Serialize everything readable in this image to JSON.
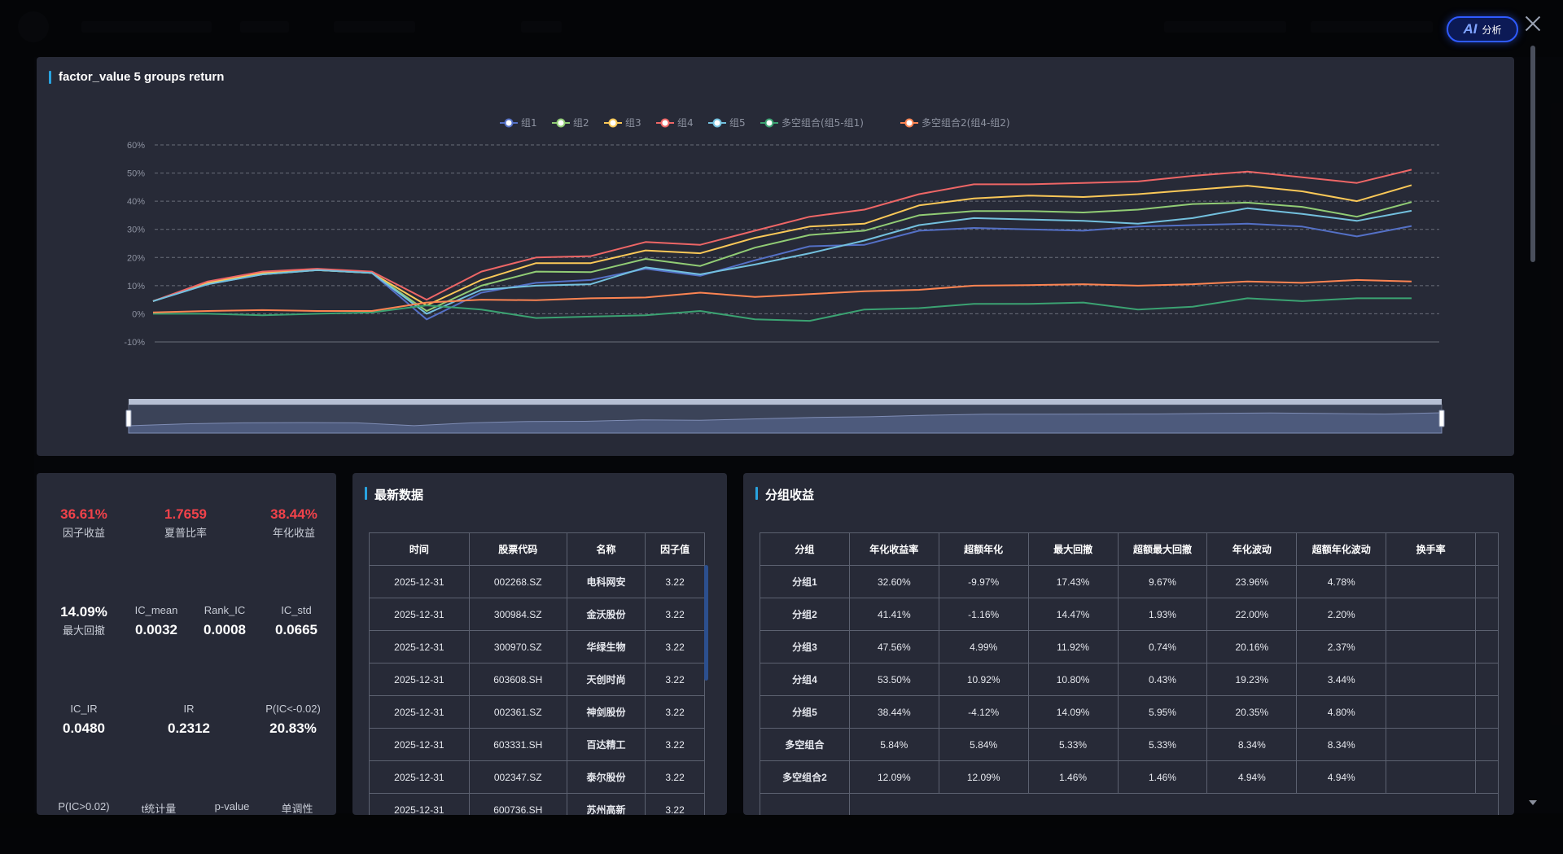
{
  "ai_button": {
    "mark": "AI",
    "label": "分析"
  },
  "chart_panel": {
    "title": "factor_value 5 groups return"
  },
  "chart_data": {
    "type": "line",
    "legend_position": "top-center",
    "grid": true,
    "y_tick_labels": [
      "60%",
      "50%",
      "40%",
      "30%",
      "20%",
      "10%",
      "0%",
      "-10%"
    ],
    "ylim": [
      -10,
      60
    ],
    "series": [
      {
        "name": "组1",
        "color": "#5470c6",
        "values": [
          4.5,
          10.5,
          14,
          15.5,
          14.5,
          -2,
          7.5,
          11,
          12,
          16,
          13.5,
          19,
          24,
          24.5,
          29.5,
          30.5,
          30,
          29.5,
          31,
          31.5,
          32,
          31,
          27.5,
          31.2
        ]
      },
      {
        "name": "组2",
        "color": "#91cc75",
        "values": [
          4.5,
          11,
          14,
          15.5,
          14.5,
          1,
          10,
          15,
          14.8,
          19.5,
          17,
          23.5,
          28,
          29.5,
          35,
          36.5,
          36.5,
          36,
          37,
          39,
          39.5,
          38,
          34.5,
          39.7
        ]
      },
      {
        "name": "组3",
        "color": "#fac858",
        "values": [
          4.5,
          11,
          14.5,
          15.5,
          14.5,
          3,
          12,
          18,
          18,
          22.5,
          21.5,
          27,
          31,
          32,
          38.5,
          41,
          42,
          41.5,
          42.5,
          44,
          45.5,
          43.5,
          40,
          45.7
        ]
      },
      {
        "name": "组4",
        "color": "#ee6666",
        "values": [
          4.5,
          11.5,
          15,
          16,
          15,
          5,
          15,
          20,
          20.5,
          25.5,
          24.5,
          29.5,
          34.5,
          37,
          42.5,
          46,
          46,
          46.5,
          47,
          49,
          50.5,
          48.5,
          46.5,
          51.2
        ]
      },
      {
        "name": "组5",
        "color": "#73c0de",
        "values": [
          4.5,
          10.5,
          14,
          15.5,
          14.5,
          0,
          8.5,
          10,
          10.5,
          16.5,
          14,
          17.5,
          21.5,
          26,
          31.5,
          34,
          33.5,
          33,
          32,
          34,
          37.5,
          35.5,
          33,
          36.6
        ]
      },
      {
        "name": "多空组合(组5-组1)",
        "color": "#3ba272",
        "values": [
          0,
          0,
          -0.5,
          0,
          0.5,
          3,
          1.5,
          -1.5,
          -1,
          -0.5,
          1,
          -2,
          -2.5,
          1.5,
          2,
          3.5,
          3.5,
          4,
          1.5,
          2.5,
          5.5,
          4.5,
          5.5,
          5.5
        ]
      },
      {
        "name": "多空组合2(组4-组2)",
        "color": "#fc8452",
        "values": [
          0.5,
          1,
          1.3,
          1,
          1,
          4,
          5,
          4.8,
          5.5,
          5.8,
          7.5,
          6,
          7,
          8,
          8.5,
          10,
          10.2,
          10.5,
          10,
          10.5,
          11.5,
          11,
          12,
          11.5
        ]
      }
    ],
    "datazoom": {
      "start": 0,
      "end": 100
    }
  },
  "metrics": {
    "factor_return": {
      "value": "36.61%",
      "label": "因子收益"
    },
    "sharpe": {
      "value": "1.7659",
      "label": "夏普比率"
    },
    "annual_return": {
      "value": "38.44%",
      "label": "年化收益"
    },
    "max_drawdown": {
      "value": "14.09%",
      "label": "最大回撤"
    },
    "ic_mean": {
      "value": "0.0032",
      "label": "IC_mean"
    },
    "rank_ic": {
      "value": "0.0008",
      "label": "Rank_IC"
    },
    "ic_std": {
      "value": "0.0665",
      "label": "IC_std"
    },
    "ic_ir": {
      "value": "0.0480",
      "label": "IC_IR"
    },
    "ir": {
      "value": "0.2312",
      "label": "IR"
    },
    "p_ic_neg": {
      "value": "20.83%",
      "label": "P(IC<-0.02)"
    },
    "p_ic_pos": {
      "label": "P(IC>0.02)"
    },
    "t_stat": {
      "label": "t统计量"
    },
    "p_value": {
      "label": "p-value"
    },
    "monotonic": {
      "label": "单调性"
    }
  },
  "latest": {
    "title": "最新数据",
    "headers": [
      "时间",
      "股票代码",
      "名称",
      "因子值"
    ],
    "rows": [
      [
        "2025-12-31",
        "002268.SZ",
        "电科网安",
        "3.22"
      ],
      [
        "2025-12-31",
        "300984.SZ",
        "金沃股份",
        "3.22"
      ],
      [
        "2025-12-31",
        "300970.SZ",
        "华绿生物",
        "3.22"
      ],
      [
        "2025-12-31",
        "603608.SH",
        "天创时尚",
        "3.22"
      ],
      [
        "2025-12-31",
        "002361.SZ",
        "神剑股份",
        "3.22"
      ],
      [
        "2025-12-31",
        "603331.SH",
        "百达精工",
        "3.22"
      ],
      [
        "2025-12-31",
        "002347.SZ",
        "泰尔股份",
        "3.22"
      ],
      [
        "2025-12-31",
        "600736.SH",
        "苏州高新",
        "3.22"
      ]
    ]
  },
  "groups": {
    "title": "分组收益",
    "headers": [
      "分组",
      "年化收益率",
      "超额年化",
      "最大回撤",
      "超额最大回撤",
      "年化波动",
      "超额年化波动",
      "换手率",
      ""
    ],
    "rows": [
      [
        "分组1",
        "32.60%",
        "-9.97%",
        "17.43%",
        "9.67%",
        "23.96%",
        "4.78%",
        "",
        ""
      ],
      [
        "分组2",
        "41.41%",
        "-1.16%",
        "14.47%",
        "1.93%",
        "22.00%",
        "2.20%",
        "",
        ""
      ],
      [
        "分组3",
        "47.56%",
        "4.99%",
        "11.92%",
        "0.74%",
        "20.16%",
        "2.37%",
        "",
        ""
      ],
      [
        "分组4",
        "53.50%",
        "10.92%",
        "10.80%",
        "0.43%",
        "19.23%",
        "3.44%",
        "",
        ""
      ],
      [
        "分组5",
        "38.44%",
        "-4.12%",
        "14.09%",
        "5.95%",
        "20.35%",
        "4.80%",
        "",
        ""
      ],
      [
        "多空组合",
        "5.84%",
        "5.84%",
        "5.33%",
        "5.33%",
        "8.34%",
        "8.34%",
        "",
        ""
      ],
      [
        "多空组合2",
        "12.09%",
        "12.09%",
        "1.46%",
        "1.46%",
        "4.94%",
        "4.94%",
        "",
        ""
      ]
    ]
  }
}
